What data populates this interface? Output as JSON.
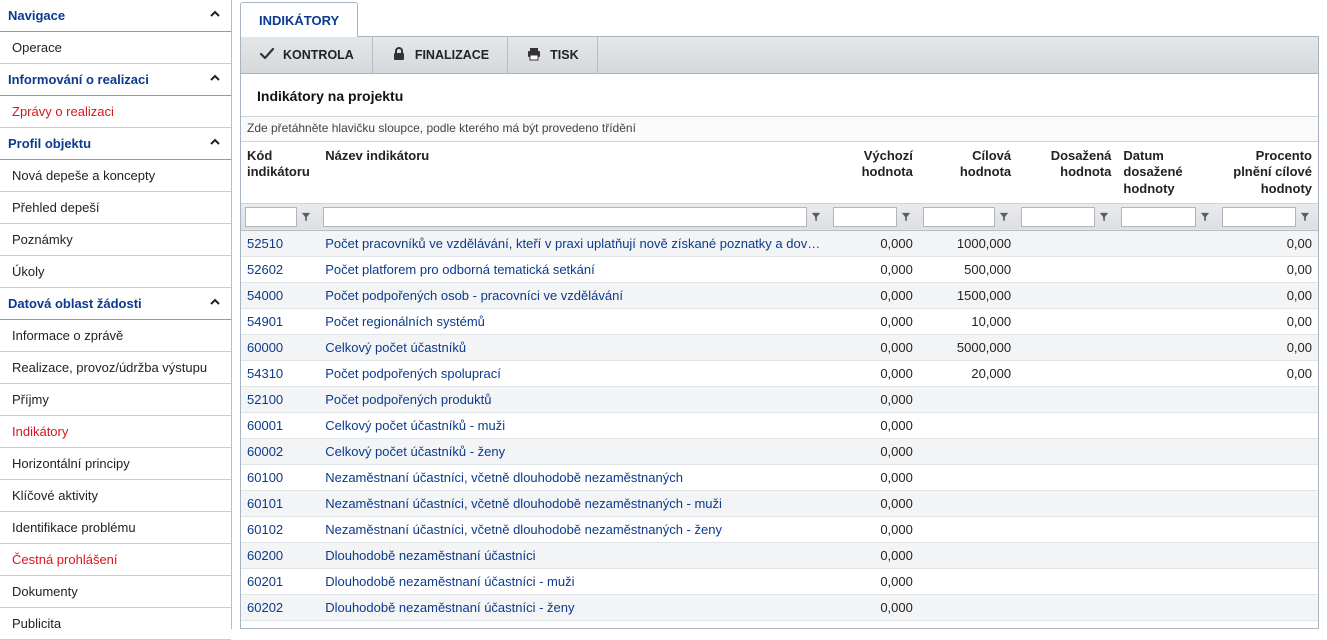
{
  "sidebar": {
    "groups": [
      {
        "label": "Navigace",
        "items": [
          {
            "label": "Operace",
            "red": false
          }
        ]
      },
      {
        "label": "Informování o realizaci",
        "items": [
          {
            "label": "Zprávy o realizaci",
            "red": true
          }
        ]
      },
      {
        "label": "Profil objektu",
        "items": [
          {
            "label": "Nová depeše a koncepty",
            "red": false
          },
          {
            "label": "Přehled depeší",
            "red": false
          },
          {
            "label": "Poznámky",
            "red": false
          },
          {
            "label": "Úkoly",
            "red": false
          }
        ]
      },
      {
        "label": "Datová oblast žádosti",
        "items": [
          {
            "label": "Informace o zprávě",
            "red": false
          },
          {
            "label": "Realizace, provoz/údržba výstupu",
            "red": false
          },
          {
            "label": "Příjmy",
            "red": false
          },
          {
            "label": "Indikátory",
            "red": true
          },
          {
            "label": "Horizontální principy",
            "red": false
          },
          {
            "label": "Klíčové aktivity",
            "red": false
          },
          {
            "label": "Identifikace problému",
            "red": false
          },
          {
            "label": "Čestná prohlášení",
            "red": true
          },
          {
            "label": "Dokumenty",
            "red": false
          },
          {
            "label": "Publicita",
            "red": false
          }
        ]
      }
    ]
  },
  "tab_label": "INDIKÁTORY",
  "toolbar": {
    "kontrola": "KONTROLA",
    "finalizace": "FINALIZACE",
    "tisk": "TISK"
  },
  "section_title": "Indikátory na projektu",
  "drag_hint": "Zde přetáhněte hlavičku sloupce, podle kterého má být provedeno třídění",
  "columns": {
    "code": "Kód indikátoru",
    "name": "Název indikátoru",
    "start": "Výchozí hodnota",
    "target": "Cílová hodnota",
    "reached": "Dosažená hodnota",
    "date": "Datum dosažené hodnoty",
    "pct": "Procento plnění cílové hodnoty"
  },
  "rows": [
    {
      "code": "52510",
      "name": "Počet pracovníků ve vzdělávání, kteří v praxi uplatňují nově získané poznatky a dovednosti",
      "start": "0,000",
      "target": "1000,000",
      "reached": "",
      "date": "",
      "pct": "0,00"
    },
    {
      "code": "52602",
      "name": "Počet platforem pro odborná tematická setkání",
      "start": "0,000",
      "target": "500,000",
      "reached": "",
      "date": "",
      "pct": "0,00"
    },
    {
      "code": "54000",
      "name": "Počet podpořených osob - pracovníci ve vzdělávání",
      "start": "0,000",
      "target": "1500,000",
      "reached": "",
      "date": "",
      "pct": "0,00"
    },
    {
      "code": "54901",
      "name": "Počet regionálních systémů",
      "start": "0,000",
      "target": "10,000",
      "reached": "",
      "date": "",
      "pct": "0,00"
    },
    {
      "code": "60000",
      "name": "Celkový počet účastníků",
      "start": "0,000",
      "target": "5000,000",
      "reached": "",
      "date": "",
      "pct": "0,00"
    },
    {
      "code": "54310",
      "name": "Počet podpořených spoluprací",
      "start": "0,000",
      "target": "20,000",
      "reached": "",
      "date": "",
      "pct": "0,00"
    },
    {
      "code": "52100",
      "name": "Počet podpořených produktů",
      "start": "0,000",
      "target": "",
      "reached": "",
      "date": "",
      "pct": ""
    },
    {
      "code": "60001",
      "name": "Celkový počet účastníků - muži",
      "start": "0,000",
      "target": "",
      "reached": "",
      "date": "",
      "pct": ""
    },
    {
      "code": "60002",
      "name": "Celkový počet účastníků - ženy",
      "start": "0,000",
      "target": "",
      "reached": "",
      "date": "",
      "pct": ""
    },
    {
      "code": "60100",
      "name": "Nezaměstnaní účastníci, včetně dlouhodobě nezaměstnaných",
      "start": "0,000",
      "target": "",
      "reached": "",
      "date": "",
      "pct": ""
    },
    {
      "code": "60101",
      "name": "Nezaměstnaní účastníci, včetně dlouhodobě nezaměstnaných - muži",
      "start": "0,000",
      "target": "",
      "reached": "",
      "date": "",
      "pct": ""
    },
    {
      "code": "60102",
      "name": "Nezaměstnaní účastníci, včetně dlouhodobě nezaměstnaných - ženy",
      "start": "0,000",
      "target": "",
      "reached": "",
      "date": "",
      "pct": ""
    },
    {
      "code": "60200",
      "name": "Dlouhodobě nezaměstnaní účastníci",
      "start": "0,000",
      "target": "",
      "reached": "",
      "date": "",
      "pct": ""
    },
    {
      "code": "60201",
      "name": "Dlouhodobě nezaměstnaní účastníci - muži",
      "start": "0,000",
      "target": "",
      "reached": "",
      "date": "",
      "pct": ""
    },
    {
      "code": "60202",
      "name": "Dlouhodobě nezaměstnaní účastníci - ženy",
      "start": "0,000",
      "target": "",
      "reached": "",
      "date": "",
      "pct": ""
    }
  ]
}
